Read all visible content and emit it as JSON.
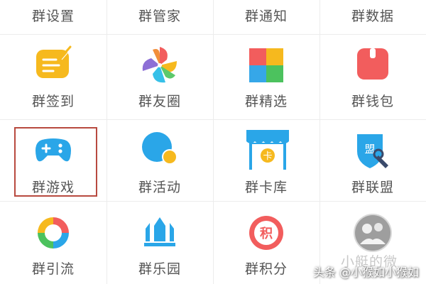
{
  "items": [
    {
      "label": "群设置",
      "icon": "settings-icon"
    },
    {
      "label": "群管家",
      "icon": "butler-icon"
    },
    {
      "label": "群通知",
      "icon": "notification-icon"
    },
    {
      "label": "群数据",
      "icon": "data-icon"
    },
    {
      "label": "群签到",
      "icon": "checkin-note-icon"
    },
    {
      "label": "群友圈",
      "icon": "pinwheel-icon"
    },
    {
      "label": "群精选",
      "icon": "color-squares-icon"
    },
    {
      "label": "群钱包",
      "icon": "wallet-icon"
    },
    {
      "label": "群游戏",
      "icon": "gamepad-icon"
    },
    {
      "label": "群活动",
      "icon": "activity-circle-icon"
    },
    {
      "label": "群卡库",
      "icon": "card-store-icon"
    },
    {
      "label": "群联盟",
      "icon": "alliance-shield-icon"
    },
    {
      "label": "群引流",
      "icon": "ring-icon"
    },
    {
      "label": "群乐园",
      "icon": "park-icon"
    },
    {
      "label": "群积分",
      "icon": "points-icon"
    }
  ],
  "badges": {
    "wallet": "",
    "card_coin": "卡",
    "alliance": "盟",
    "points": "积"
  },
  "faded_label": "小艇的微",
  "watermark": "头条 @小猴如小猴如"
}
